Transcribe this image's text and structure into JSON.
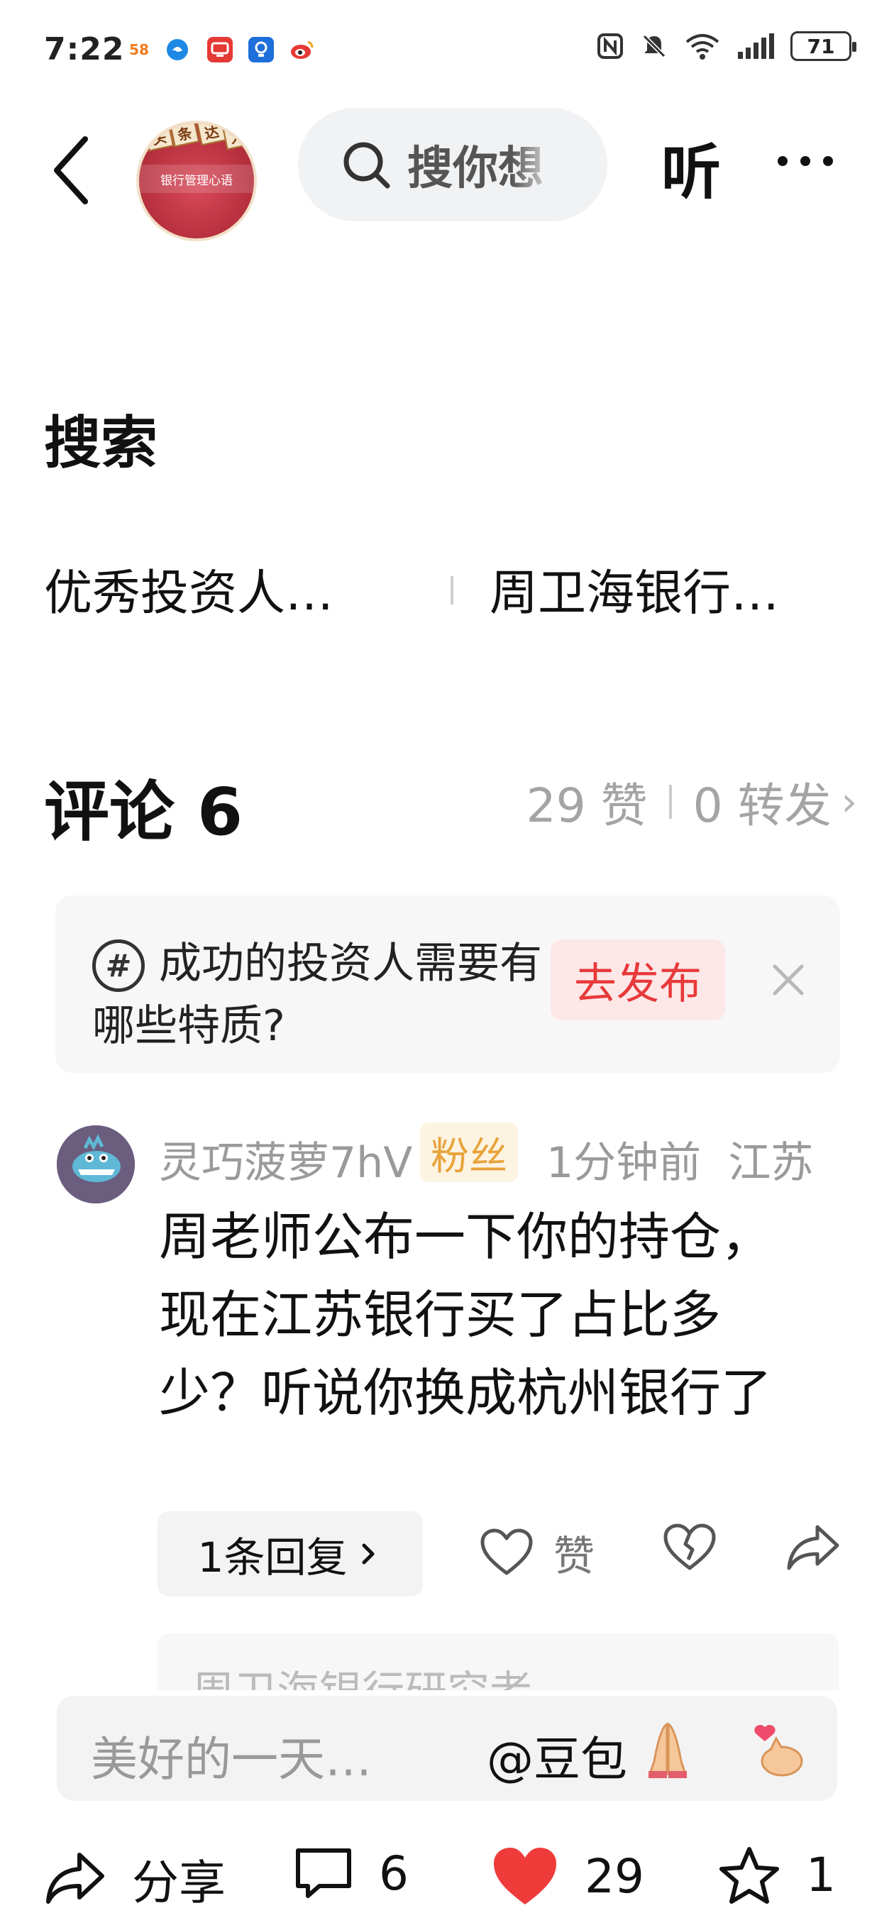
{
  "status_bar": {
    "time": "7:22",
    "notification_icons": [
      {
        "name": "58-app-icon",
        "label": "58",
        "color": "#f07a1a"
      },
      {
        "name": "edge-browser-icon",
        "label": "e",
        "color": "#1e88e5"
      },
      {
        "name": "tv-app-icon",
        "label": "▣",
        "color": "#e53935"
      },
      {
        "name": "bulb-app-icon",
        "label": "◉",
        "color": "#1e6fd9"
      },
      {
        "name": "weibo-icon",
        "label": "◕",
        "color": "#e8a31a"
      }
    ],
    "battery": "71"
  },
  "header": {
    "search_placeholder": "搜你想",
    "listen_label": "听",
    "avatar_tags": [
      "头",
      "条",
      "达",
      "人"
    ],
    "avatar_book_title": "银行管理心语"
  },
  "search_section": {
    "title": "搜索",
    "related": [
      "优秀投资人…",
      "周卫海银行…"
    ]
  },
  "comments": {
    "title": "评论 6",
    "likes": "29 赞",
    "shares": "0 转发",
    "topic": {
      "text": "成功的投资人需要有哪些特质?",
      "button": "去发布"
    },
    "items": [
      {
        "username": "灵巧菠萝7hV",
        "badge": "粉丝",
        "time": "1分钟前",
        "location": "江苏",
        "text": "周老师公布一下你的持仓，现在江苏银行买了占比多少？听说你换成杭州银行了",
        "reply_label": "1条回复",
        "like_label": "赞"
      }
    ],
    "sub_reply_preview": "周卫海银行研究者"
  },
  "input_bar": {
    "placeholder": "美好的一天…",
    "mention": "@豆包"
  },
  "bottom_bar": {
    "share_label": "分享",
    "comment_count": "6",
    "like_count": "29",
    "favorite_count": "1"
  },
  "colors": {
    "accent_red": "#e8393a",
    "like_red": "#f03b3b",
    "badge_orange": "#e8a33a"
  }
}
